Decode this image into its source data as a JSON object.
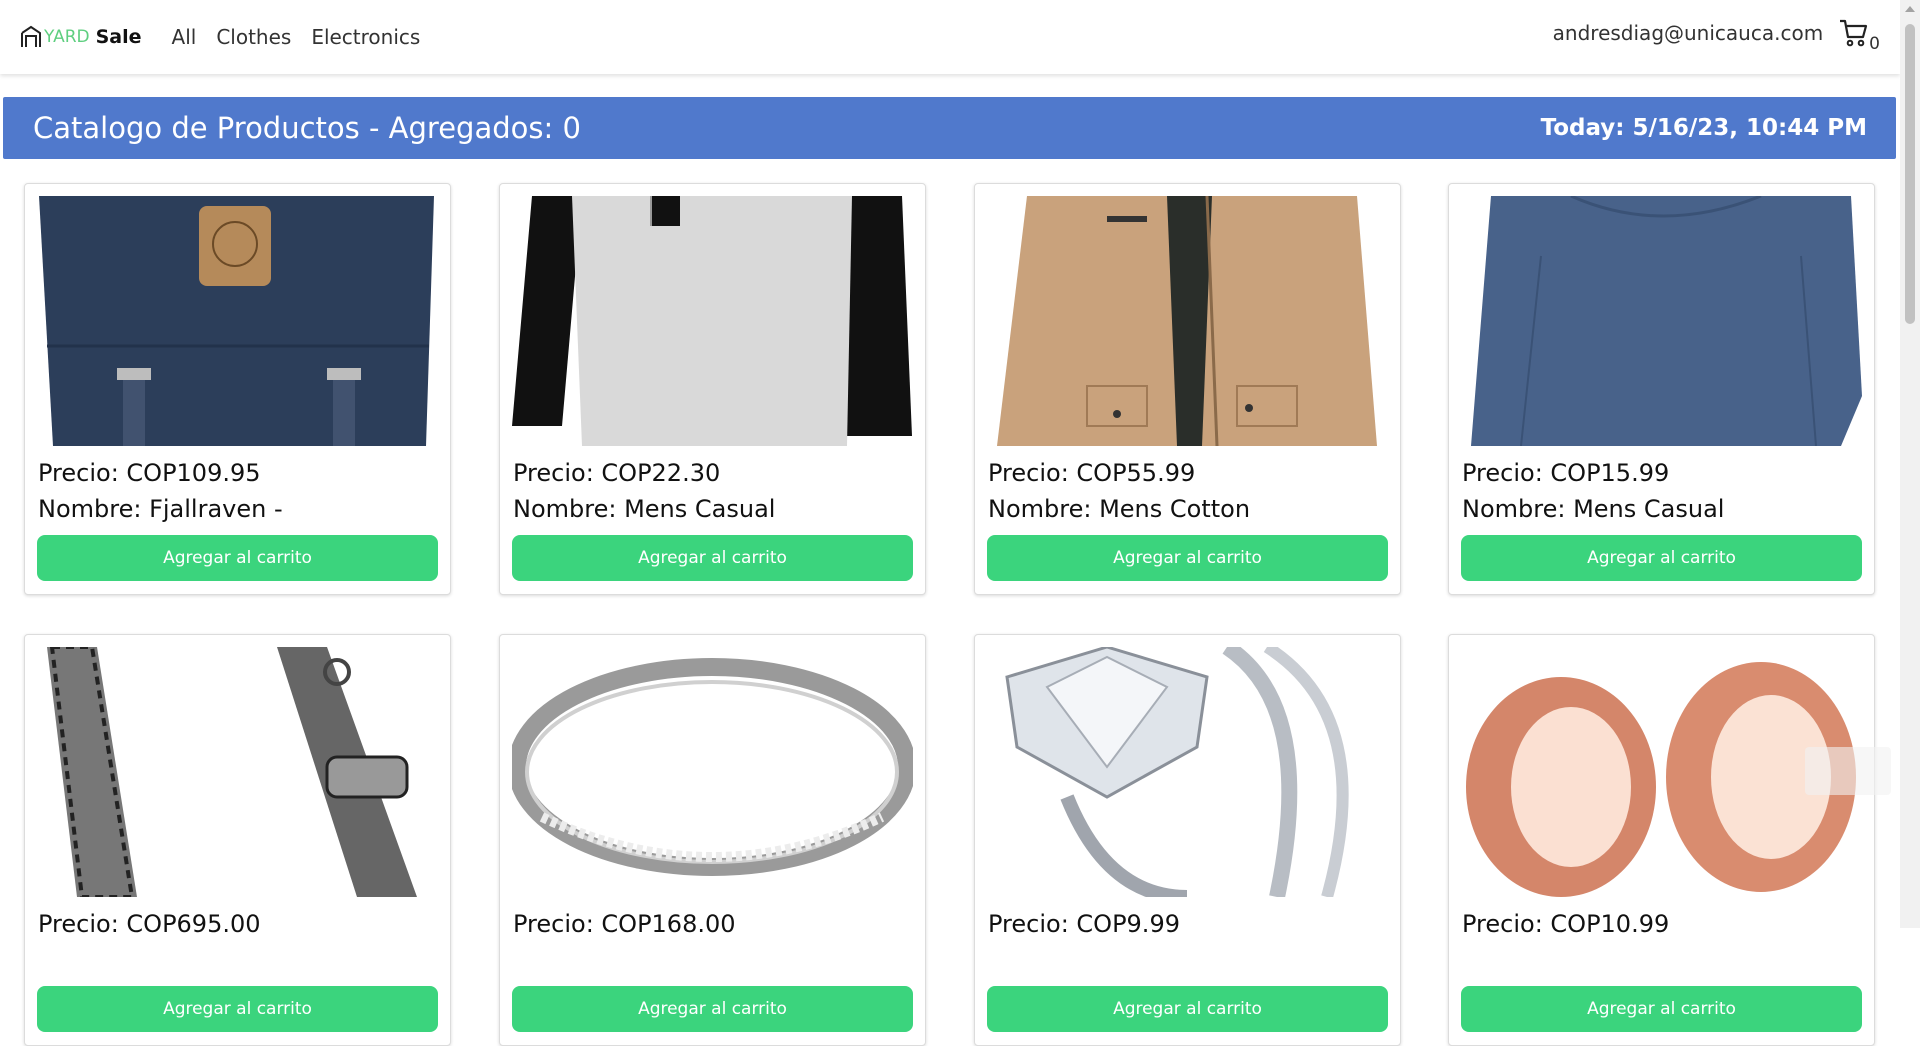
{
  "navbar": {
    "brand_yard": "YARD",
    "brand_sale": "Sale",
    "links": [
      "All",
      "Clothes",
      "Electronics"
    ],
    "user_email": "andresdiag@unicauca.com",
    "cart_count": "0"
  },
  "header": {
    "title": "Catalogo de Productos - Agregados: 0",
    "date": "Today: 5/16/23, 10:44 PM"
  },
  "products": [
    {
      "price": "Precio: COP109.95",
      "name": "Nombre: Fjallraven -",
      "button": "Agregar al carrito",
      "image": "backpack"
    },
    {
      "price": "Precio: COP22.30",
      "name": "Nombre: Mens Casual",
      "button": "Agregar al carrito",
      "image": "raglan-tshirt"
    },
    {
      "price": "Precio: COP55.99",
      "name": "Nombre: Mens Cotton",
      "button": "Agregar al carrito",
      "image": "cotton-jacket"
    },
    {
      "price": "Precio: COP15.99",
      "name": "Nombre: Mens Casual",
      "button": "Agregar al carrito",
      "image": "slim-fit-shirt"
    },
    {
      "price": "Precio: COP695.00",
      "name": "",
      "button": "Agregar al carrito",
      "image": "chain-bracelet"
    },
    {
      "price": "Precio: COP168.00",
      "name": "",
      "button": "Agregar al carrito",
      "image": "silver-ring"
    },
    {
      "price": "Precio: COP9.99",
      "name": "",
      "button": "Agregar al carrito",
      "image": "diamond-ring"
    },
    {
      "price": "Precio: COP10.99",
      "name": "",
      "button": "Agregar al carrito",
      "image": "rose-gold-plugs"
    }
  ],
  "colors": {
    "header_bg": "#5079cc",
    "button_bg": "#3bd47d",
    "brand_accent": "#5fcf80"
  }
}
